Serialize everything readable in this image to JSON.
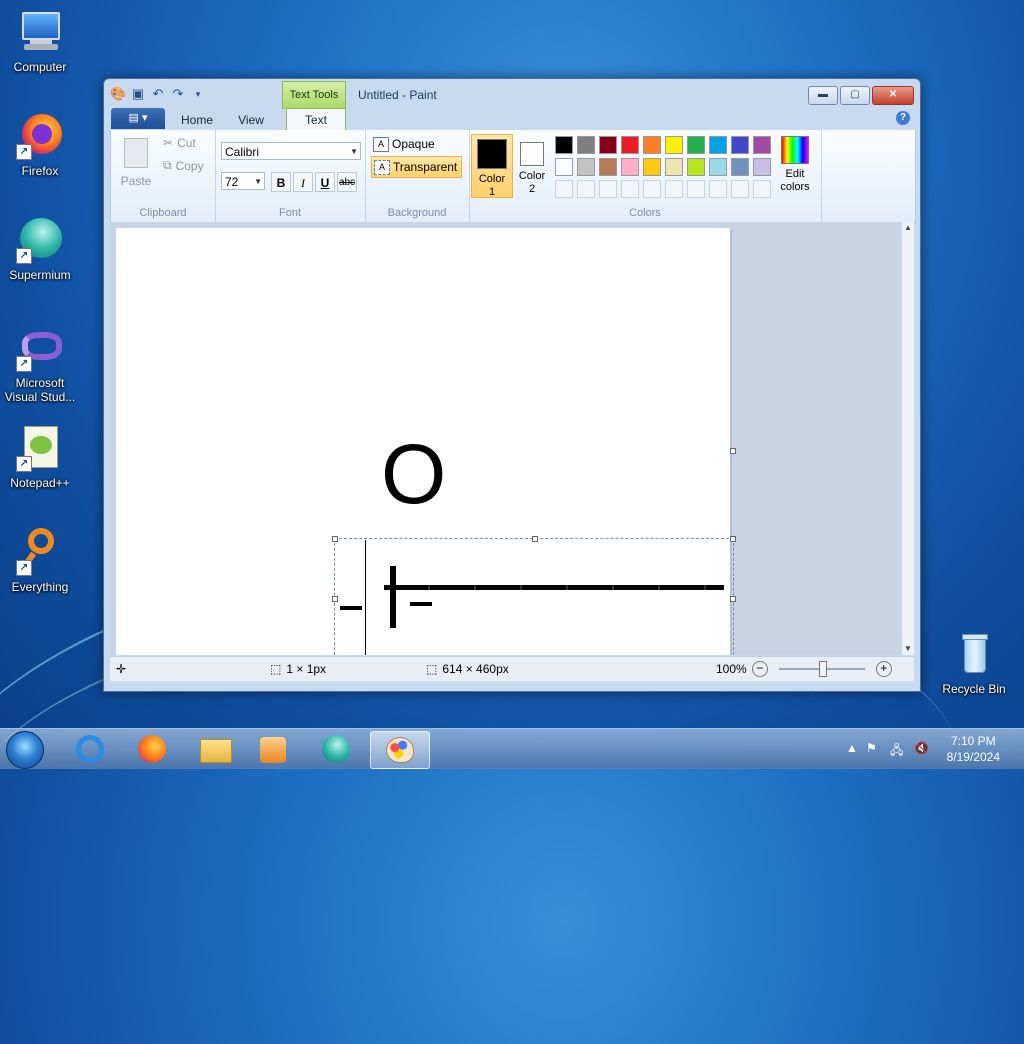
{
  "desktop": {
    "icons": [
      {
        "label": "Computer"
      },
      {
        "label": "Firefox"
      },
      {
        "label": "Supermium"
      },
      {
        "label": "Microsoft Visual Stud..."
      },
      {
        "label": "Notepad++"
      },
      {
        "label": "Everything"
      },
      {
        "label": "Recycle Bin"
      }
    ]
  },
  "window": {
    "title": "Untitled - Paint",
    "contextual_tab": "Text Tools",
    "tabs": [
      "Home",
      "View",
      "Text"
    ],
    "active_tab": "Text"
  },
  "ribbon": {
    "clipboard": {
      "label": "Clipboard",
      "paste": "Paste",
      "cut": "Cut",
      "copy": "Copy"
    },
    "font": {
      "label": "Font",
      "family": "Calibri",
      "size": "72",
      "bold": "B",
      "italic": "I",
      "underline": "U",
      "strike": "abc"
    },
    "background": {
      "label": "Background",
      "opaque": "Opaque",
      "transparent": "Transparent",
      "selected": "Transparent"
    },
    "colors": {
      "label": "Colors",
      "color1_label": "Color 1",
      "color2_label": "Color 2",
      "color1": "#000000",
      "color2": "#ffffff",
      "edit_label": "Edit colors",
      "palette_row1": [
        "#000000",
        "#7f7f7f",
        "#880015",
        "#ed1c24",
        "#ff7f27",
        "#fff200",
        "#22b14c",
        "#00a2e8",
        "#3f48cc",
        "#a349a4"
      ],
      "palette_row2": [
        "#ffffff",
        "#c3c3c3",
        "#b97a57",
        "#ffaec9",
        "#ffc90e",
        "#efe4b0",
        "#b5e61d",
        "#99d9ea",
        "#7092be",
        "#c8bfe7"
      ]
    }
  },
  "canvas": {
    "letter": "O"
  },
  "status": {
    "cursor_size": "1 × 1px",
    "canvas_size": "614 × 460px",
    "zoom": "100%"
  },
  "taskbar": {
    "time": "7:10 PM",
    "date": "8/19/2024"
  }
}
